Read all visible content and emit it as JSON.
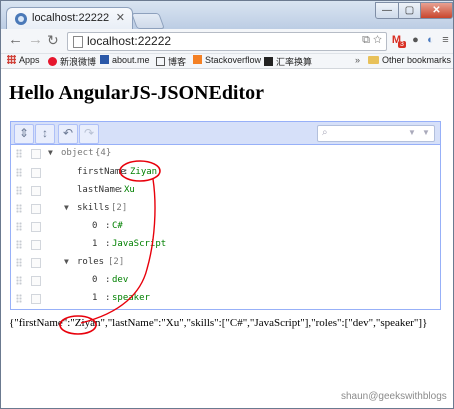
{
  "browser": {
    "tab_title": "localhost:22222",
    "url": "localhost:22222",
    "buttons": {
      "minimize": "—",
      "maximize": "▢",
      "close": "✕"
    },
    "gmail_badge": "3"
  },
  "bookmarks": {
    "items": [
      {
        "label": "Apps",
        "icon": "apps-icon"
      },
      {
        "label": "新浪微博",
        "icon": "weibo-icon"
      },
      {
        "label": "about.me",
        "icon": "aboutme-icon"
      },
      {
        "label": "博客",
        "icon": "blog-icon"
      },
      {
        "label": "Stackoverflow",
        "icon": "stackoverflow-icon"
      },
      {
        "label": "汇率换算",
        "icon": "notion-icon"
      }
    ],
    "other": "Other bookmarks",
    "overflow": "»"
  },
  "page": {
    "title": "Hello AngularJS-JSONEditor"
  },
  "editor": {
    "rows": [
      {
        "indent": 0,
        "expander": "▼",
        "field": "object",
        "meta": "{4}"
      },
      {
        "indent": 1,
        "field": "firstName",
        "value": "Ziyan"
      },
      {
        "indent": 1,
        "field": "lastName",
        "value": "Xu"
      },
      {
        "indent": 1,
        "expander": "▼",
        "field": "skills",
        "meta": "[2]"
      },
      {
        "indent": 2,
        "field": "0",
        "value": "C#"
      },
      {
        "indent": 2,
        "field": "1",
        "value": "JavaScript"
      },
      {
        "indent": 1,
        "expander": "▼",
        "field": "roles",
        "meta": "[2]"
      },
      {
        "indent": 2,
        "field": "0",
        "value": "dev"
      },
      {
        "indent": 2,
        "field": "1",
        "value": "speaker"
      }
    ]
  },
  "json_output": "{\"firstName\":\"Ziyan\",\"lastName\":\"Xu\",\"skills\":[\"C#\",\"JavaScript\"],\"roles\":[\"dev\",\"speaker\"]}",
  "watermark": "shaun@geekswithblogs",
  "colors": {
    "annotation": "#e8000b",
    "string_value": "#008000",
    "editor_border": "#97b0f8",
    "menubar": "#d6e0f9"
  }
}
